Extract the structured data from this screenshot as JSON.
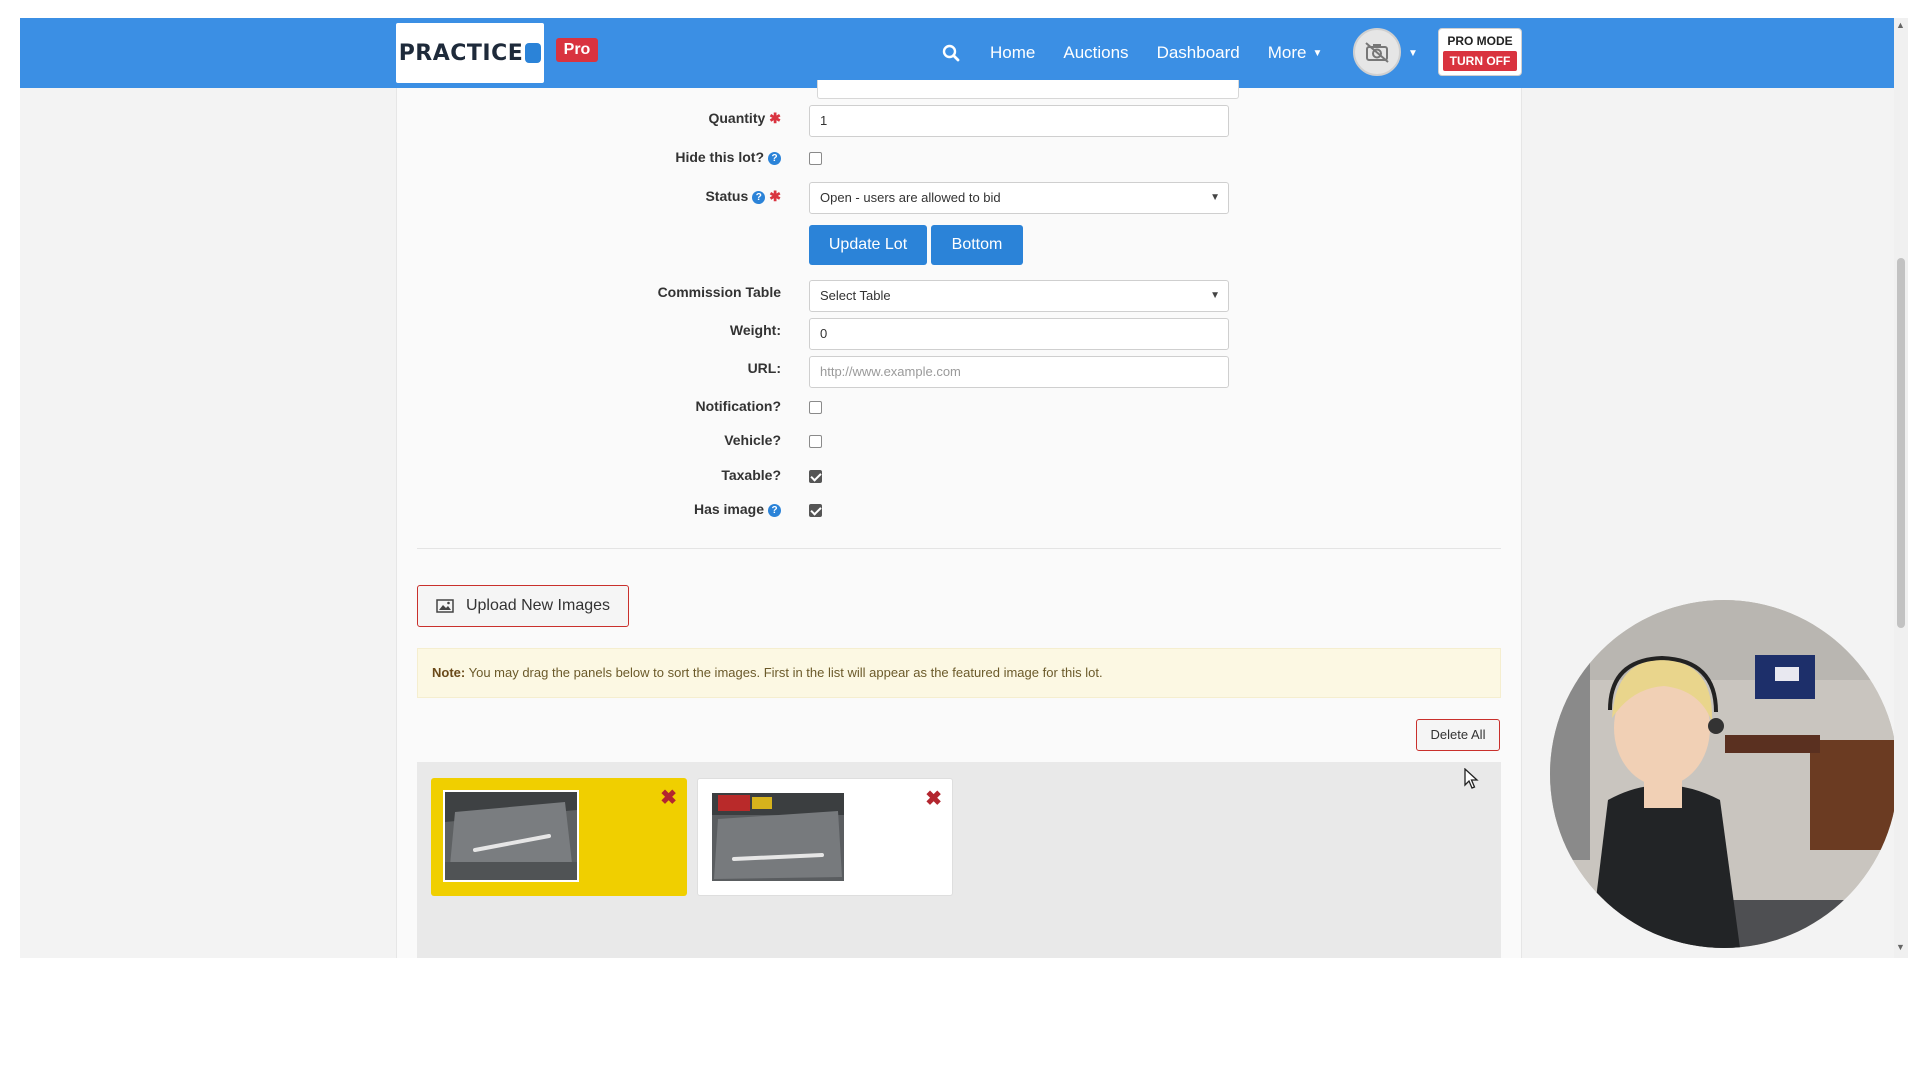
{
  "navbar": {
    "logo_text": "PRACTICE",
    "pro_badge": "Pro",
    "links": [
      "Home",
      "Auctions",
      "Dashboard",
      "More"
    ],
    "pro_mode_label": "PRO MODE",
    "pro_mode_button": "TURN OFF"
  },
  "form": {
    "quantity_label": "Quantity",
    "quantity_value": "1",
    "hide_lot_label": "Hide this lot?",
    "hide_lot_checked": false,
    "status_label": "Status",
    "status_value": "Open - users are allowed to bid",
    "update_button": "Update Lot",
    "bottom_button": "Bottom",
    "commission_label": "Commission Table",
    "commission_value": "Select Table",
    "weight_label": "Weight:",
    "weight_value": "0",
    "url_label": "URL:",
    "url_placeholder": "http://www.example.com",
    "notification_label": "Notification?",
    "notification_checked": false,
    "vehicle_label": "Vehicle?",
    "vehicle_checked": false,
    "taxable_label": "Taxable?",
    "taxable_checked": true,
    "has_image_label": "Has image",
    "has_image_checked": true
  },
  "images": {
    "upload_button": "Upload New Images",
    "note_bold": "Note:",
    "note_text": "You may drag the panels below to sort the images. First in the list will appear as the featured image for this lot.",
    "delete_all_button": "Delete All",
    "items": [
      {
        "featured": true
      },
      {
        "featured": false
      }
    ]
  },
  "colors": {
    "navbar": "#3b8fe4",
    "primary_button": "#2b83d8",
    "danger": "#d9333f",
    "featured_card": "#f0cf00",
    "note_bg": "#fcf8e3"
  }
}
